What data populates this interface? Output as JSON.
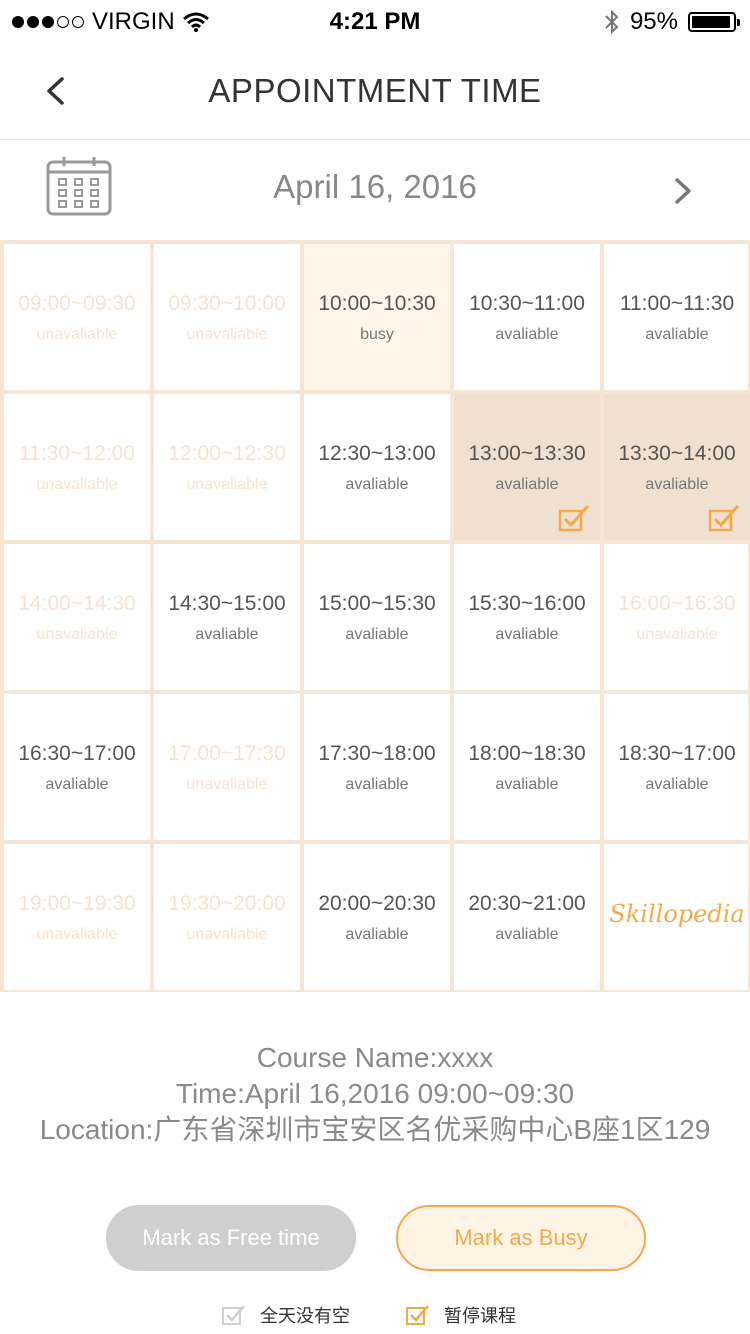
{
  "status_bar": {
    "carrier": "VIRGIN",
    "time": "4:21 PM",
    "battery": "95%",
    "battery_level": 0.95,
    "signal_bars_filled": 3,
    "signal_bars_total": 5
  },
  "nav": {
    "title": "APPOINTMENT TIME",
    "back_icon": "chevron-left-icon"
  },
  "date_bar": {
    "date": "April 16, 2016",
    "calendar_icon": "calendar-icon",
    "next_icon": "chevron-right-icon"
  },
  "slots": [
    {
      "time": "09:00~09:30",
      "status": "unavaliable",
      "state": "unavaliable"
    },
    {
      "time": "09:30~10:00",
      "status": "unavaliable",
      "state": "unavaliable"
    },
    {
      "time": "10:00~10:30",
      "status": "busy",
      "state": "busy"
    },
    {
      "time": "10:30~11:00",
      "status": "avaliable",
      "state": "avaliable"
    },
    {
      "time": "11:00~11:30",
      "status": "avaliable",
      "state": "avaliable"
    },
    {
      "time": "11:30~12:00",
      "status": "unavaliable",
      "state": "unavaliable"
    },
    {
      "time": "12:00~12:30",
      "status": "unavaliable",
      "state": "unavaliable"
    },
    {
      "time": "12:30~13:00",
      "status": "avaliable",
      "state": "avaliable"
    },
    {
      "time": "13:00~13:30",
      "status": "avaliable",
      "state": "selected"
    },
    {
      "time": "13:30~14:00",
      "status": "avaliable",
      "state": "selected"
    },
    {
      "time": "14:00~14:30",
      "status": "unavaliable",
      "state": "unavaliable"
    },
    {
      "time": "14:30~15:00",
      "status": "avaliable",
      "state": "avaliable"
    },
    {
      "time": "15:00~15:30",
      "status": "avaliable",
      "state": "avaliable"
    },
    {
      "time": "15:30~16:00",
      "status": "avaliable",
      "state": "avaliable"
    },
    {
      "time": "16:00~16:30",
      "status": "unavaliable",
      "state": "unavaliable"
    },
    {
      "time": "16:30~17:00",
      "status": "avaliable",
      "state": "avaliable"
    },
    {
      "time": "17:00~17:30",
      "status": "unavaliable",
      "state": "unavaliable"
    },
    {
      "time": "17:30~18:00",
      "status": "avaliable",
      "state": "avaliable"
    },
    {
      "time": "18:00~18:30",
      "status": "avaliable",
      "state": "avaliable"
    },
    {
      "time": "18:30~17:00",
      "status": "avaliable",
      "state": "avaliable"
    },
    {
      "time": "19:00~19:30",
      "status": "unavaliable",
      "state": "unavaliable"
    },
    {
      "time": "19:30~20:00",
      "status": "unavaliable",
      "state": "unavaliable"
    },
    {
      "time": "20:00~20:30",
      "status": "avaliable",
      "state": "avaliable"
    },
    {
      "time": "20:30~21:00",
      "status": "avaliable",
      "state": "avaliable"
    },
    {
      "time": "",
      "status": "",
      "state": "logo"
    }
  ],
  "brand": "Skillopedia",
  "info": {
    "course": "Course Name:xxxx",
    "time": "Time:April 16,2016 09:00~09:30",
    "location": "Location:广东省深圳市宝安区名优采购中心B座1区129"
  },
  "buttons": {
    "free": "Mark as Free time",
    "busy": "Mark as Busy"
  },
  "options": [
    {
      "label": "全天没有空",
      "checked": false
    },
    {
      "label": "暂停课程",
      "checked": true
    }
  ],
  "colors": {
    "accent": "#f3a94a",
    "grid_border": "#f5e6d6",
    "busy_bg": "#fef4e8",
    "selected_bg": "#efe0d0",
    "unavailable_text": "#f5e3d2"
  }
}
